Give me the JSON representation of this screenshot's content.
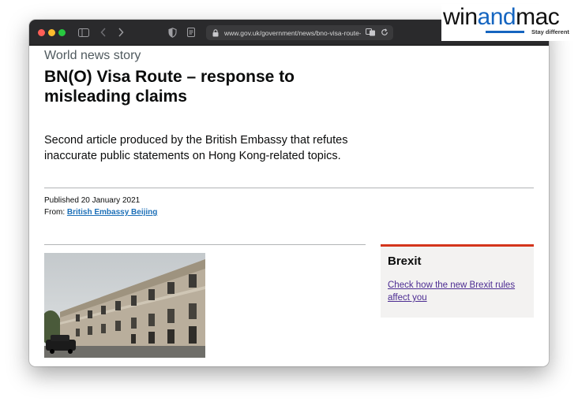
{
  "browser": {
    "url": "www.gov.uk/government/news/bno-visa-route-",
    "icons": [
      "sidebar-icon",
      "back-icon",
      "forward-icon",
      "shield-icon",
      "reader-icon",
      "lock-icon",
      "translate-icon",
      "reload-icon"
    ]
  },
  "article": {
    "context": "World news story",
    "title": "BN(O) Visa Route – response to misleading claims",
    "lead": "Second article produced by the British Embassy that refutes inaccurate public statements on Hong Kong-related topics.",
    "published": "Published 20 January 2021",
    "from_label": "From:",
    "from_link": "British Embassy Beijing"
  },
  "sidebar_box": {
    "title": "Brexit",
    "link": "Check how the new Brexit rules affect you",
    "accent": "#d4351c"
  },
  "watermark": {
    "part1": "win",
    "part2": "and",
    "part3": "mac",
    "tagline": "Stay different",
    "accent": "#1565c0"
  }
}
